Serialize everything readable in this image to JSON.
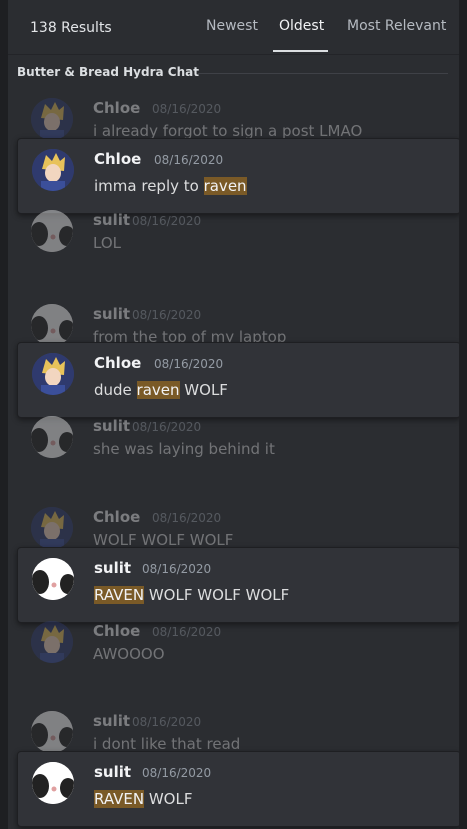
{
  "header": {
    "results": "138 Results",
    "tabs": [
      {
        "label": "Newest",
        "active": false
      },
      {
        "label": "Oldest",
        "active": true
      },
      {
        "label": "Most Relevant",
        "active": false
      }
    ]
  },
  "channel": "Butter & Bread Hydra Chat",
  "messages": [
    {
      "kind": "context",
      "author": "Chloe",
      "date": "08/16/2020",
      "text": "i already forgot to sign a post LMAO"
    },
    {
      "kind": "result",
      "author": "Chloe",
      "date": "08/16/2020",
      "text_before": "imma reply to ",
      "highlight": "raven",
      "text_after": ""
    },
    {
      "kind": "context",
      "author": "sulit",
      "date": "08/16/2020",
      "text": "LOL"
    },
    {
      "kind": "context",
      "author": "sulit",
      "date": "08/16/2020",
      "text": "from the top of my laptop"
    },
    {
      "kind": "result",
      "author": "Chloe",
      "date": "08/16/2020",
      "text_before": "dude ",
      "highlight": "raven",
      "text_after": " WOLF"
    },
    {
      "kind": "context",
      "author": "sulit",
      "date": "08/16/2020",
      "text": "she was laying behind it"
    },
    {
      "kind": "context",
      "author": "Chloe",
      "date": "08/16/2020",
      "text": "WOLF WOLF WOLF"
    },
    {
      "kind": "result",
      "author": "sulit",
      "date": "08/16/2020",
      "text_before": "",
      "highlight": "RAVEN",
      "text_after": " WOLF WOLF WOLF"
    },
    {
      "kind": "context",
      "author": "Chloe",
      "date": "08/16/2020",
      "text": "AWOOOO"
    },
    {
      "kind": "context",
      "author": "sulit",
      "date": "08/16/2020",
      "text": "i dont like that read"
    },
    {
      "kind": "result",
      "author": "sulit",
      "date": "08/16/2020",
      "text_before": "",
      "highlight": "RAVEN",
      "text_after": " WOLF"
    }
  ]
}
